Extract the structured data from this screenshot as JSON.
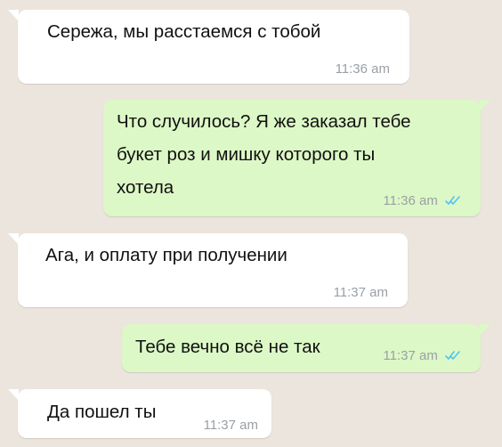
{
  "messages": [
    {
      "direction": "incoming",
      "text": "Сережа, мы расстаемся с тобой",
      "time": "11:36 am"
    },
    {
      "direction": "outgoing",
      "text": "Что случилось? Я же заказал тебе\nбукет роз и мишку которого ты\nхотела",
      "time": "11:36 am",
      "status_icon": "double-check-icon"
    },
    {
      "direction": "incoming",
      "text": "Ага, и оплату при получении",
      "time": "11:37 am"
    },
    {
      "direction": "outgoing",
      "text": "Тебе вечно всё не так",
      "time": "11:37 am",
      "status_icon": "double-check-icon"
    },
    {
      "direction": "incoming",
      "text": "Да пошел ты",
      "time": "11:37 am"
    }
  ],
  "colors": {
    "background": "#ece5dd",
    "incoming_bubble": "#ffffff",
    "outgoing_bubble": "#dcf8c6",
    "timestamp": "#9aa0a6",
    "read_check": "#4fc3f7"
  }
}
